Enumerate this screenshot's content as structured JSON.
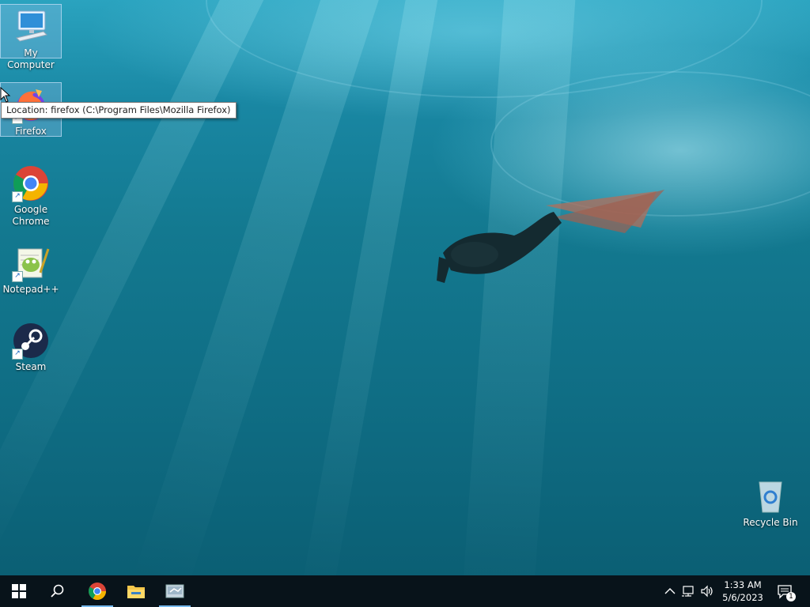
{
  "desktop": {
    "icons": [
      {
        "label": "My Computer"
      },
      {
        "label": "Firefox"
      },
      {
        "label": "Google Chrome"
      },
      {
        "label": "Notepad++"
      },
      {
        "label": "Steam"
      },
      {
        "label": "Recycle Bin"
      }
    ],
    "tooltip": "Location: firefox (C:\\Program Files\\Mozilla Firefox)"
  },
  "taskbar": {
    "clock_time": "1:33 AM",
    "clock_date": "5/6/2023",
    "notification_count": "1",
    "accent_color": "#76b9ed"
  }
}
